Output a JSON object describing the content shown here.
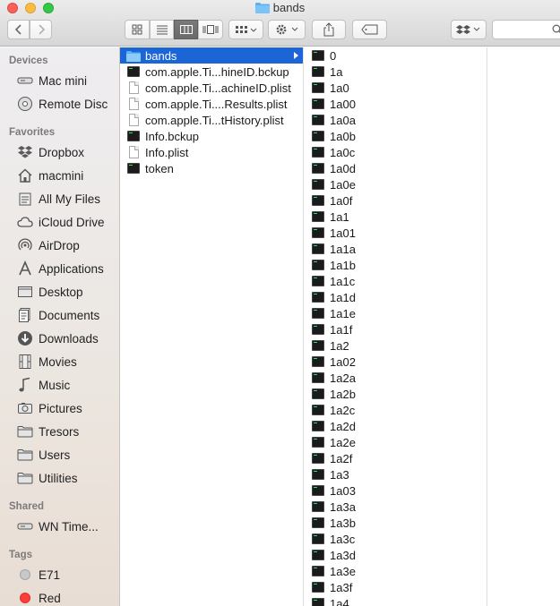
{
  "window": {
    "title": "bands"
  },
  "sidebar": {
    "sections": [
      {
        "heading": "Devices",
        "items": [
          {
            "label": "Mac mini",
            "icon": "mac-mini-icon"
          },
          {
            "label": "Remote Disc",
            "icon": "disc-icon"
          }
        ]
      },
      {
        "heading": "Favorites",
        "items": [
          {
            "label": "Dropbox",
            "icon": "dropbox-icon"
          },
          {
            "label": "macmini",
            "icon": "home-icon"
          },
          {
            "label": "All My Files",
            "icon": "all-files-icon"
          },
          {
            "label": "iCloud Drive",
            "icon": "cloud-icon"
          },
          {
            "label": "AirDrop",
            "icon": "airdrop-icon"
          },
          {
            "label": "Applications",
            "icon": "applications-icon"
          },
          {
            "label": "Desktop",
            "icon": "desktop-icon"
          },
          {
            "label": "Documents",
            "icon": "documents-icon"
          },
          {
            "label": "Downloads",
            "icon": "downloads-icon"
          },
          {
            "label": "Movies",
            "icon": "movies-icon"
          },
          {
            "label": "Music",
            "icon": "music-icon"
          },
          {
            "label": "Pictures",
            "icon": "pictures-icon"
          },
          {
            "label": "Tresors",
            "icon": "folder-icon"
          },
          {
            "label": "Users",
            "icon": "folder-icon"
          },
          {
            "label": "Utilities",
            "icon": "folder-icon"
          }
        ]
      },
      {
        "heading": "Shared",
        "items": [
          {
            "label": "WN Time...",
            "icon": "server-icon"
          }
        ]
      },
      {
        "heading": "Tags",
        "items": [
          {
            "label": "E71",
            "icon": "tag-gray-icon"
          },
          {
            "label": "Red",
            "icon": "tag-red-icon"
          }
        ]
      }
    ]
  },
  "columns": [
    {
      "items": [
        {
          "label": "bands",
          "icon": "folder-icon",
          "selected": true
        },
        {
          "label": "com.apple.Ti...hineID.bckup",
          "icon": "executable-icon"
        },
        {
          "label": "com.apple.Ti...achineID.plist",
          "icon": "document-icon"
        },
        {
          "label": "com.apple.Ti....Results.plist",
          "icon": "document-icon"
        },
        {
          "label": "com.apple.Ti...tHistory.plist",
          "icon": "document-icon"
        },
        {
          "label": "Info.bckup",
          "icon": "executable-icon"
        },
        {
          "label": "Info.plist",
          "icon": "document-icon"
        },
        {
          "label": "token",
          "icon": "executable-icon"
        }
      ]
    },
    {
      "items": [
        {
          "label": "0",
          "icon": "executable-icon"
        },
        {
          "label": "1a",
          "icon": "executable-icon"
        },
        {
          "label": "1a0",
          "icon": "executable-icon"
        },
        {
          "label": "1a00",
          "icon": "executable-icon"
        },
        {
          "label": "1a0a",
          "icon": "executable-icon"
        },
        {
          "label": "1a0b",
          "icon": "executable-icon"
        },
        {
          "label": "1a0c",
          "icon": "executable-icon"
        },
        {
          "label": "1a0d",
          "icon": "executable-icon"
        },
        {
          "label": "1a0e",
          "icon": "executable-icon"
        },
        {
          "label": "1a0f",
          "icon": "executable-icon"
        },
        {
          "label": "1a1",
          "icon": "executable-icon"
        },
        {
          "label": "1a01",
          "icon": "executable-icon"
        },
        {
          "label": "1a1a",
          "icon": "executable-icon"
        },
        {
          "label": "1a1b",
          "icon": "executable-icon"
        },
        {
          "label": "1a1c",
          "icon": "executable-icon"
        },
        {
          "label": "1a1d",
          "icon": "executable-icon"
        },
        {
          "label": "1a1e",
          "icon": "executable-icon"
        },
        {
          "label": "1a1f",
          "icon": "executable-icon"
        },
        {
          "label": "1a2",
          "icon": "executable-icon"
        },
        {
          "label": "1a02",
          "icon": "executable-icon"
        },
        {
          "label": "1a2a",
          "icon": "executable-icon"
        },
        {
          "label": "1a2b",
          "icon": "executable-icon"
        },
        {
          "label": "1a2c",
          "icon": "executable-icon"
        },
        {
          "label": "1a2d",
          "icon": "executable-icon"
        },
        {
          "label": "1a2e",
          "icon": "executable-icon"
        },
        {
          "label": "1a2f",
          "icon": "executable-icon"
        },
        {
          "label": "1a3",
          "icon": "executable-icon"
        },
        {
          "label": "1a03",
          "icon": "executable-icon"
        },
        {
          "label": "1a3a",
          "icon": "executable-icon"
        },
        {
          "label": "1a3b",
          "icon": "executable-icon"
        },
        {
          "label": "1a3c",
          "icon": "executable-icon"
        },
        {
          "label": "1a3d",
          "icon": "executable-icon"
        },
        {
          "label": "1a3e",
          "icon": "executable-icon"
        },
        {
          "label": "1a3f",
          "icon": "executable-icon"
        },
        {
          "label": "1a4",
          "icon": "executable-icon"
        }
      ]
    }
  ],
  "colors": {
    "selection": "#1c65d6",
    "tag_red": "#fc3d39",
    "tag_gray": "#c8c8c8"
  }
}
